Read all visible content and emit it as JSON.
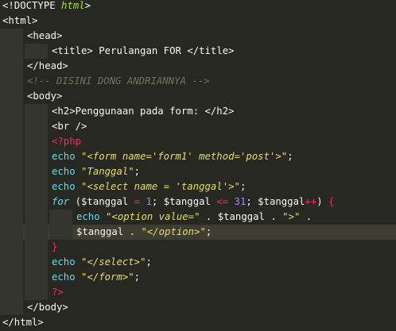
{
  "editor": {
    "lines": [
      {
        "indent": 0,
        "tokens": [
          [
            "doctype-kw",
            "<!DOCTYPE "
          ],
          [
            "doctype-val",
            "html"
          ],
          [
            "doctype-kw",
            ">"
          ]
        ]
      },
      {
        "indent": 0,
        "tokens": [
          [
            "tag",
            "<html>"
          ]
        ]
      },
      {
        "indent": 1,
        "tokens": [
          [
            "tag",
            "<head>"
          ]
        ]
      },
      {
        "indent": 2,
        "tokens": [
          [
            "tag",
            "<title>"
          ],
          [
            "plain",
            " Perulangan FOR "
          ],
          [
            "tag",
            "</title>"
          ]
        ]
      },
      {
        "indent": 1,
        "tokens": [
          [
            "tag",
            "</head>"
          ]
        ]
      },
      {
        "indent": 1,
        "tokens": [
          [
            "comment",
            "<!-- DISINI DONG ANDRIANNYA -->"
          ]
        ]
      },
      {
        "indent": 1,
        "tokens": [
          [
            "tag",
            "<body>"
          ]
        ]
      },
      {
        "indent": 2,
        "tokens": [
          [
            "tag",
            "<h2>"
          ],
          [
            "plain",
            "Penggunaan pada form: "
          ],
          [
            "tag",
            "</h2>"
          ]
        ]
      },
      {
        "indent": 2,
        "tokens": [
          [
            "tag",
            "<br />"
          ]
        ]
      },
      {
        "indent": 2,
        "tokens": [
          [
            "php",
            "<?php"
          ]
        ]
      },
      {
        "indent": 2,
        "tokens": [
          [
            "fn",
            "echo "
          ],
          [
            "str",
            "\""
          ],
          [
            "str-i",
            "<form name='form1' method='post'>"
          ],
          [
            "str",
            "\""
          ],
          [
            "plain",
            ";"
          ]
        ]
      },
      {
        "indent": 2,
        "tokens": [
          [
            "fn",
            "echo "
          ],
          [
            "str",
            "\""
          ],
          [
            "str-i",
            "Tanggal"
          ],
          [
            "str",
            "\""
          ],
          [
            "plain",
            ";"
          ]
        ]
      },
      {
        "indent": 2,
        "tokens": [
          [
            "fn",
            "echo "
          ],
          [
            "str",
            "\""
          ],
          [
            "str-i",
            "<select name = 'tanggal'>"
          ],
          [
            "str",
            "\""
          ],
          [
            "plain",
            ";"
          ]
        ]
      },
      {
        "indent": 2,
        "tokens": [
          [
            "ctl",
            "for"
          ],
          [
            "plain",
            " ("
          ],
          [
            "plain",
            "$tanggal"
          ],
          [
            "op",
            " = "
          ],
          [
            "num",
            "1"
          ],
          [
            "plain",
            "; $tanggal "
          ],
          [
            "op",
            "<="
          ],
          [
            "plain",
            " "
          ],
          [
            "num",
            "31"
          ],
          [
            "plain",
            "; $tanggal"
          ],
          [
            "op",
            "++"
          ],
          [
            "plain",
            ") "
          ],
          [
            "brace-hl",
            "{"
          ]
        ]
      },
      {
        "indent": 3,
        "tokens": [
          [
            "fn",
            "echo "
          ],
          [
            "str",
            "\""
          ],
          [
            "str-i",
            "<option value="
          ],
          [
            "str",
            "\""
          ],
          [
            "plain",
            " . $tanggal . "
          ],
          [
            "str",
            "\""
          ],
          [
            "str-i",
            ">"
          ],
          [
            "str",
            "\""
          ],
          [
            "plain",
            " ."
          ]
        ]
      },
      {
        "indent": 3,
        "current": true,
        "tokens": [
          [
            "plain",
            "$tanggal . "
          ],
          [
            "str",
            "\""
          ],
          [
            "str-i",
            "</option>"
          ],
          [
            "str",
            "\""
          ],
          [
            "plain",
            ";"
          ]
        ]
      },
      {
        "indent": 2,
        "tokens": [
          [
            "brace-hl",
            "}"
          ]
        ]
      },
      {
        "indent": 2,
        "tokens": [
          [
            "fn",
            "echo "
          ],
          [
            "str",
            "\""
          ],
          [
            "str-i",
            "</select>"
          ],
          [
            "str",
            "\""
          ],
          [
            "plain",
            ";"
          ]
        ]
      },
      {
        "indent": 2,
        "tokens": [
          [
            "fn",
            "echo "
          ],
          [
            "str",
            "\""
          ],
          [
            "str-i",
            "</form>"
          ],
          [
            "str",
            "\""
          ],
          [
            "plain",
            ";"
          ]
        ]
      },
      {
        "indent": 2,
        "tokens": [
          [
            "php",
            "?>"
          ]
        ]
      },
      {
        "indent": 1,
        "tokens": [
          [
            "tag",
            "</body>"
          ]
        ]
      },
      {
        "indent": 0,
        "tokens": [
          [
            "tag",
            "</html>"
          ]
        ]
      }
    ]
  },
  "colors": {
    "background": "#272822",
    "current_line": "#3e3d32",
    "indent_guide": "#34352d",
    "keyword": "#f92672",
    "function": "#66d9ef",
    "string": "#e6db74",
    "number": "#ae81ff",
    "comment": "#75715e",
    "tag": "#f8f8f2",
    "doctype_value": "#a6e22e"
  }
}
